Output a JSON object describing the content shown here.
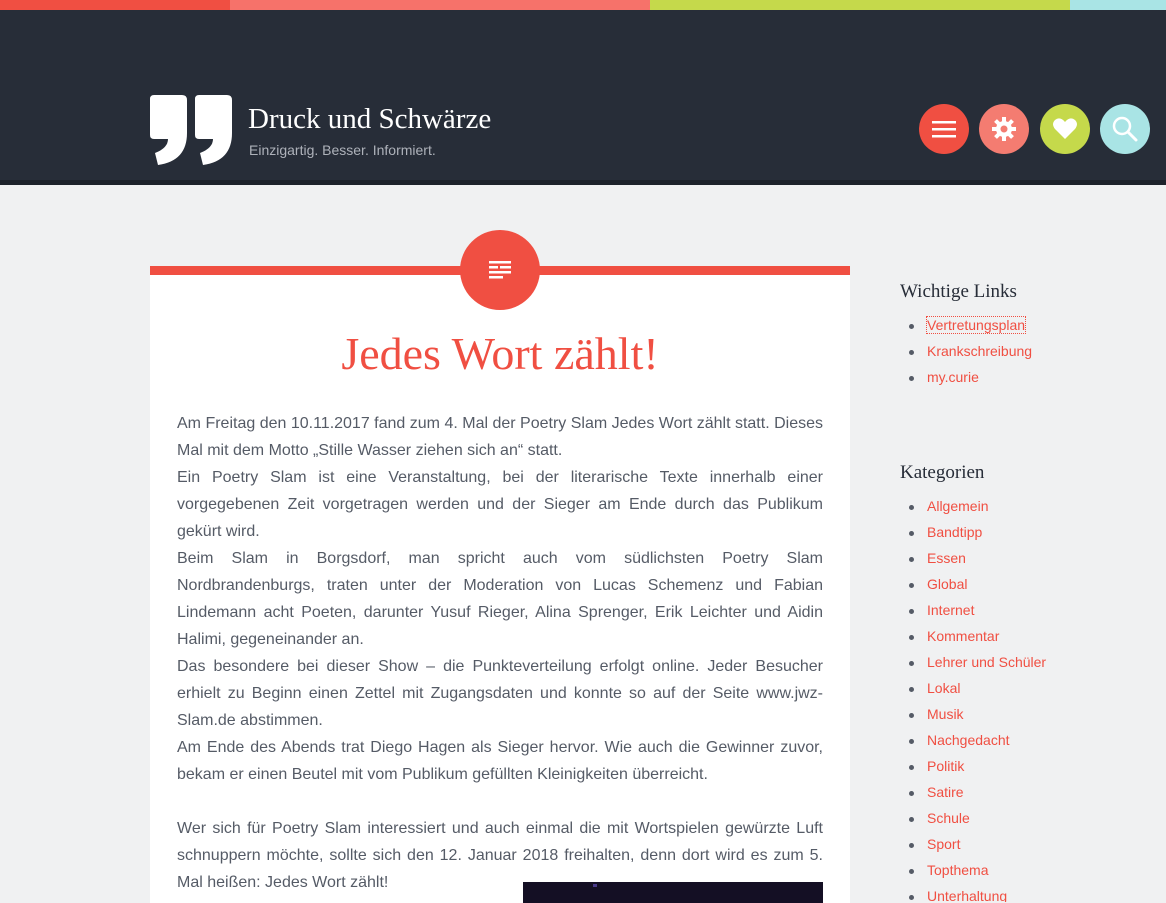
{
  "colors": {
    "topbar": [
      "#f04f42",
      "#f6726a",
      "#c5d94b",
      "#a9e4e5"
    ],
    "header_bg": "#272d38",
    "accent": "#f04f42",
    "button_menu": "#f04f42",
    "button_settings": "#f47c71",
    "button_heart": "#c5d94b",
    "button_search": "#a9e4e5"
  },
  "header": {
    "logo_icon": "quote-mark-icon",
    "title": "Druck und Schwärze",
    "description": "Einzigartig. Besser. Informiert.",
    "buttons": [
      {
        "icon": "menu-icon"
      },
      {
        "icon": "gear-icon"
      },
      {
        "icon": "heart-icon"
      },
      {
        "icon": "search-icon"
      }
    ]
  },
  "post": {
    "format_icon": "text-format-icon",
    "title": "Jedes Wort zählt!",
    "paragraphs": [
      "Am Freitag den 10.11.2017 fand zum 4. Mal der Poetry Slam Jedes Wort zählt statt. Dieses Mal mit dem Motto „Stille Wasser ziehen sich an“ statt.",
      "Ein Poetry Slam ist eine Veranstaltung, bei der literarische Texte innerhalb einer vorgegebenen Zeit vorgetragen werden und der Sieger am Ende durch das Publikum gekürt wird.",
      "Beim Slam in Borgsdorf, man spricht auch vom südlichsten Poetry Slam Nordbrandenburgs, traten unter der Moderation von Lucas Schemenz und Fabian Lindemann acht Poeten, darunter Yusuf Rieger, Alina Sprenger, Erik Leichter und Aidin Halimi, gegeneinander an.",
      "Das besondere bei dieser Show – die Punkteverteilung erfolgt online. Jeder Besucher erhielt zu Beginn einen Zettel mit Zugangsdaten und konnte so auf der Seite www.jwz-Slam.de abstimmen.",
      "Am Ende des Abends trat Diego Hagen als Sieger hervor. Wie auch die Gewinner zuvor, bekam er einen Beutel mit vom Publikum gefüllten Kleinigkeiten überreicht."
    ],
    "closing": "Wer sich für Poetry Slam interessiert und auch einmal die mit Wortspielen gewürzte Luft schnuppern möchte, sollte sich den 12. Januar 2018 freihalten, denn dort wird es zum 5. Mal heißen: Jedes Wort zählt!"
  },
  "sidebar": {
    "links_title": "Wichtige Links",
    "links": [
      "Vertretungsplan",
      "Krankschreibung",
      "my.curie"
    ],
    "categories_title": "Kategorien",
    "categories": [
      "Allgemein",
      "Bandtipp",
      "Essen",
      "Global",
      "Internet",
      "Kommentar",
      "Lehrer und Schüler",
      "Lokal",
      "Musik",
      "Nachgedacht",
      "Politik",
      "Satire",
      "Schule",
      "Sport",
      "Topthema",
      "Unterhaltung"
    ]
  }
}
